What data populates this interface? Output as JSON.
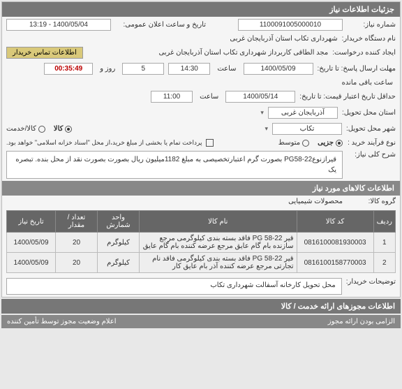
{
  "panel": {
    "title": "جزئیات اطلاعات نیاز"
  },
  "need_no": {
    "label": "شماره نیاز:",
    "value": "1100091005000010"
  },
  "announce": {
    "label": "تاریخ و ساعت اعلان عمومی:",
    "value": "1400/05/04 - 13:19"
  },
  "buyer_org": {
    "label": "نام دستگاه خریدار:",
    "value": "شهرداری تکاب استان آذربایجان غربی"
  },
  "creator": {
    "label": "ایجاد کننده درخواست:",
    "value": "مجد الطاقی کاربرداز شهرداری تکاب استان آذربایجان غربی",
    "contact_btn": "اطلاعات تماس خریدار"
  },
  "deadline": {
    "label_from": "مهلت ارسال پاسخ: تا تاریخ:",
    "date": "1400/05/09",
    "time_label": "ساعت",
    "time": "14:30",
    "days_label": "روز و",
    "days": "5",
    "remain_label": "ساعت باقی مانده",
    "remain": "00:35:49"
  },
  "validity": {
    "label": "حداقل تاریخ اعتبار قیمت: تا تاریخ:",
    "date": "1400/05/14",
    "time_label": "ساعت",
    "time": "11:00"
  },
  "province": {
    "label": "استان محل تحویل:",
    "value": "آذربایجان غربی"
  },
  "city": {
    "label": "شهر محل تحویل:",
    "value": "تکاب"
  },
  "buy_type": {
    "label": "نوع فرآیند خرید :",
    "opts": [
      "جزیی",
      "متوسط"
    ],
    "selected": 0,
    "type2_opts": [
      "کالا",
      "کالا/خدمت"
    ],
    "type2_selected": 0
  },
  "pay_note": {
    "checkbox_label": "",
    "text": "پرداخت تمام یا بخشی از مبلغ خرید،از محل \"اسناد خزانه اسلامی\" خواهد بود."
  },
  "summary": {
    "label": "شرح کلی نیاز:",
    "text": "قیرازنوعPG58-22 بصورت گرم اعتبارتخصیصی به مبلغ 1182میلیون ریال بصورت بصورت نقد از محل بنده. تبصره یک"
  },
  "goods_panel": {
    "title": "اطلاعات کالاهای مورد نیاز"
  },
  "group": {
    "label": "گروه کالا:",
    "value": "محصولات شیمیایی"
  },
  "table": {
    "headers": [
      "ردیف",
      "کد کالا",
      "نام کالا",
      "واحد شمارش",
      "تعداد / مقدار",
      "تاریخ نیاز"
    ],
    "rows": [
      {
        "idx": "1",
        "code": "0816100081930003",
        "name": "قیر PG 58-22 فاقد بسته بندی کیلوگرمی مرجع سازنده بام گام عایق مرجع عرضه کننده بام گام عایق",
        "unit": "کیلوگرم",
        "qty": "20",
        "date": "1400/05/09"
      },
      {
        "idx": "2",
        "code": "0816100158770003",
        "name": "قیر PG 58-22 فاقد بسته بندی کیلوگرمی فاقد نام تجارتی مرجع عرضه کننده آذر بام عایق کار",
        "unit": "کیلوگرم",
        "qty": "20",
        "date": "1400/05/09"
      }
    ]
  },
  "buyer_notes": {
    "label": "توضیحات خریدار:",
    "text": "محل تحویل کارخانه آسفالت شهرداری تکاب"
  },
  "permits_panel": {
    "title": "اطلاعات مجوزهای ارائه خدمت / کالا"
  },
  "footer": {
    "left": "اعلام وضعیت مجوز توسط تأمین کننده",
    "right": "الزامی بودن ارائه مجوز"
  }
}
